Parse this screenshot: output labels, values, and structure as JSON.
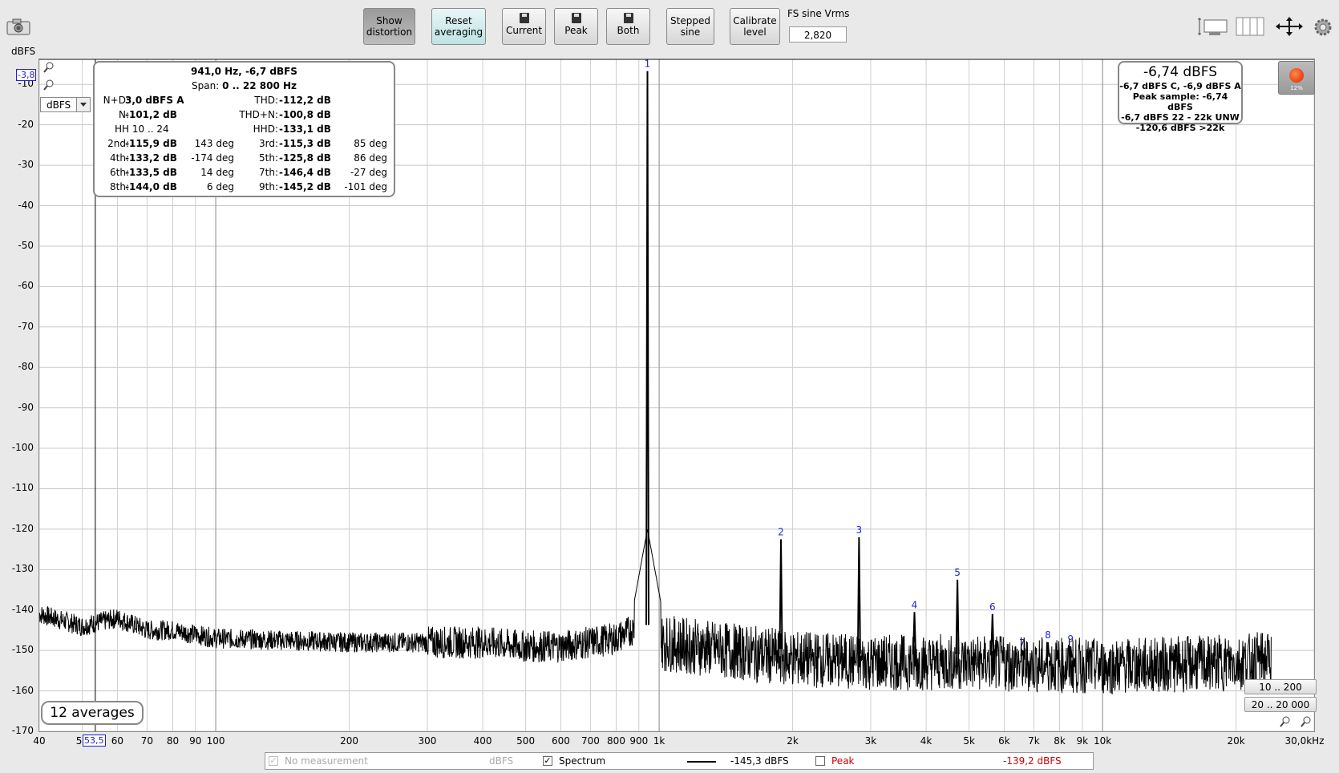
{
  "toolbar": {
    "show_distortion": "Show\ndistortion",
    "reset_averaging": "Reset\naveraging",
    "current": "Current",
    "peak": "Peak",
    "both": "Both",
    "stepped_sine": "Stepped\nsine",
    "calibrate_level": "Calibrate\nlevel",
    "fs_label": "FS sine Vrms",
    "fs_value": "2,820"
  },
  "plot": {
    "y_unit": "dBFS",
    "unit_select": "dBFS",
    "cursor_y_value": "-3,8",
    "cursor_x_value": "53,5",
    "averages": "12 averages",
    "range_buttons": [
      "10 .. 200",
      "20 .. 20 000"
    ]
  },
  "info_box": {
    "header": "941,0 Hz, -6,7 dBFS",
    "span_label": "Span:",
    "span": "0 .. 22 800 Hz",
    "nd_label": "N+D:",
    "nd": "3,0 dBFS A",
    "thd_label": "THD:",
    "thd": "-112,2 dB",
    "n_label": "N:",
    "n": "-101,2 dB",
    "thdn_label": "THD+N:",
    "thdn": "-100,8 dB",
    "hh_label": "HH 10 .. 24",
    "hhd_label": "HHD:",
    "hhd": "-133,1 dB",
    "harmonics": [
      {
        "label": "2nd:",
        "value": "-115,9 dB",
        "phase": "143 deg"
      },
      {
        "label": "3rd:",
        "value": "-115,3 dB",
        "phase": "85 deg"
      },
      {
        "label": "4th:",
        "value": "-133,2 dB",
        "phase": "-174 deg"
      },
      {
        "label": "5th:",
        "value": "-125,8 dB",
        "phase": "86 deg"
      },
      {
        "label": "6th:",
        "value": "-133,5 dB",
        "phase": "14 deg"
      },
      {
        "label": "7th:",
        "value": "-146,4 dB",
        "phase": "-27 deg"
      },
      {
        "label": "8th:",
        "value": "-144,0 dB",
        "phase": "6 deg"
      },
      {
        "label": "9th:",
        "value": "-145,2 dB",
        "phase": "-101 deg"
      }
    ]
  },
  "level_box": {
    "main": "-6,74 dBFS",
    "line1": "-6,7 dBFS C, -6,9 dBFS A",
    "line2": "Peak sample: -6,74 dBFS",
    "line3": "-6,7 dBFS 22 - 22k UNW",
    "line4": "-120,6 dBFS >22k",
    "record_pct": "12%"
  },
  "legend": {
    "no_measurement": "No measurement",
    "no_measurement_unit": "dBFS",
    "spectrum": "Spectrum",
    "spectrum_value": "-145,3 dBFS",
    "peak": "Peak",
    "peak_value": "-139,2 dBFS",
    "peak_color": "#cc0000"
  },
  "chart_data": {
    "type": "line",
    "xscale": "log",
    "xlim": [
      40,
      30000
    ],
    "ylim": [
      -170,
      -3.8
    ],
    "ylabel": "dBFS",
    "y_ticks": [
      "-10",
      "-20",
      "-30",
      "-40",
      "-50",
      "-60",
      "-70",
      "-80",
      "-90",
      "-100",
      "-110",
      "-120",
      "-130",
      "-140",
      "-150",
      "-160",
      "-170"
    ],
    "x_ticks": [
      {
        "v": 40,
        "t": "40"
      },
      {
        "v": 50,
        "t": "5"
      },
      {
        "v": 60,
        "t": "60"
      },
      {
        "v": 70,
        "t": "70"
      },
      {
        "v": 80,
        "t": "80"
      },
      {
        "v": 90,
        "t": "90"
      },
      {
        "v": 100,
        "t": "100"
      },
      {
        "v": 200,
        "t": "200"
      },
      {
        "v": 300,
        "t": "300"
      },
      {
        "v": 400,
        "t": "400"
      },
      {
        "v": 500,
        "t": "500"
      },
      {
        "v": 600,
        "t": "600"
      },
      {
        "v": 700,
        "t": "700"
      },
      {
        "v": 800,
        "t": "800"
      },
      {
        "v": 900,
        "t": "900"
      },
      {
        "v": 1000,
        "t": "1k"
      },
      {
        "v": 2000,
        "t": "2k"
      },
      {
        "v": 3000,
        "t": "3k"
      },
      {
        "v": 4000,
        "t": "4k"
      },
      {
        "v": 5000,
        "t": "5k"
      },
      {
        "v": 6000,
        "t": "6k"
      },
      {
        "v": 7000,
        "t": "7k"
      },
      {
        "v": 8000,
        "t": "8k"
      },
      {
        "v": 9000,
        "t": "9k"
      },
      {
        "v": 10000,
        "t": "10k"
      },
      {
        "v": 20000,
        "t": "20k"
      },
      {
        "v": 30000,
        "t": "30,0kHz"
      }
    ],
    "series": [
      {
        "name": "Spectrum",
        "color": "#000000",
        "noise_floor": [
          [
            40,
            -141
          ],
          [
            50,
            -144
          ],
          [
            60,
            -142
          ],
          [
            70,
            -145
          ],
          [
            80,
            -145
          ],
          [
            100,
            -147
          ],
          [
            200,
            -148
          ],
          [
            300,
            -148
          ],
          [
            400,
            -148
          ],
          [
            500,
            -149
          ],
          [
            600,
            -149
          ],
          [
            700,
            -148
          ],
          [
            800,
            -147
          ],
          [
            900,
            -144
          ],
          [
            1000,
            -148
          ],
          [
            2000,
            -152
          ],
          [
            3000,
            -153
          ],
          [
            5000,
            -153
          ],
          [
            10000,
            -154
          ],
          [
            20000,
            -153
          ],
          [
            24000,
            -152
          ]
        ],
        "peaks": [
          {
            "x": 941,
            "y": -6.7,
            "label": "1"
          },
          {
            "x": 1882,
            "y": -122.5,
            "label": "2"
          },
          {
            "x": 2823,
            "y": -122,
            "label": "3"
          },
          {
            "x": 3764,
            "y": -140.5,
            "label": "4"
          },
          {
            "x": 4705,
            "y": -132.5,
            "label": "5"
          },
          {
            "x": 5646,
            "y": -141,
            "label": "6"
          },
          {
            "x": 6587,
            "y": -150,
            "label": "7"
          },
          {
            "x": 7528,
            "y": -148,
            "label": "8"
          },
          {
            "x": 8469,
            "y": -149,
            "label": "9"
          }
        ]
      }
    ]
  }
}
